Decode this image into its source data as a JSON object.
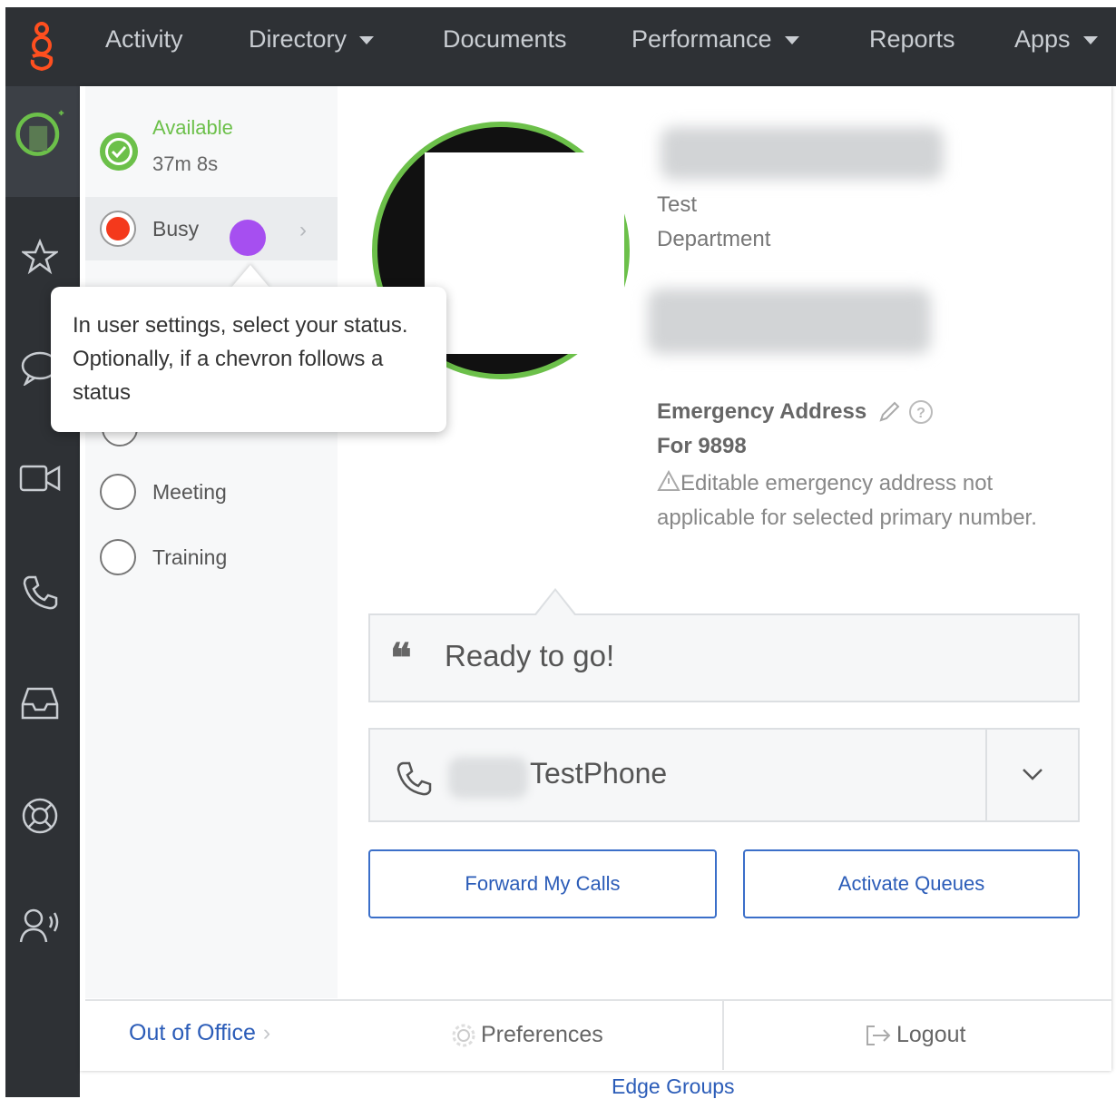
{
  "nav": {
    "items": [
      {
        "label": "Activity",
        "dropdown": false
      },
      {
        "label": "Directory",
        "dropdown": true
      },
      {
        "label": "Documents",
        "dropdown": false
      },
      {
        "label": "Performance",
        "dropdown": true
      },
      {
        "label": "Reports",
        "dropdown": false
      },
      {
        "label": "Apps",
        "dropdown": true
      }
    ]
  },
  "rail": {
    "icons": [
      "user-status-icon",
      "star-icon",
      "chat-icon",
      "video-icon",
      "phone-icon",
      "inbox-icon",
      "support-icon",
      "voice-user-icon"
    ]
  },
  "status": {
    "current": {
      "label": "Available",
      "duration": "37m 8s"
    },
    "options": [
      {
        "label": "Busy",
        "color": "#f4391c",
        "has_chevron": true
      },
      {
        "label": "Meeting"
      },
      {
        "label": "Training"
      }
    ]
  },
  "tooltip": {
    "text": "In user settings, select your status. Optionally, if a chevron follows a status"
  },
  "profile": {
    "title": "Test",
    "department": "Department",
    "emergency_label": "Emergency Address",
    "emergency_for": "For 9898",
    "emergency_note": "Editable emergency address not applicable for selected primary number."
  },
  "status_message": "Ready to go!",
  "phone": {
    "name": "TestPhone"
  },
  "buttons": {
    "forward": "Forward My Calls",
    "queues": "Activate Queues"
  },
  "footer": {
    "out_of_office": "Out of Office",
    "preferences": "Preferences",
    "logout": "Logout"
  },
  "below": {
    "edge_groups": "Edge Groups"
  },
  "colors": {
    "accent_green": "#6cc04a",
    "brand_orange": "#ff4f1f",
    "busy_red": "#f4391c",
    "link_blue": "#2b5cb8",
    "pointer_purple": "#a64ff0"
  }
}
